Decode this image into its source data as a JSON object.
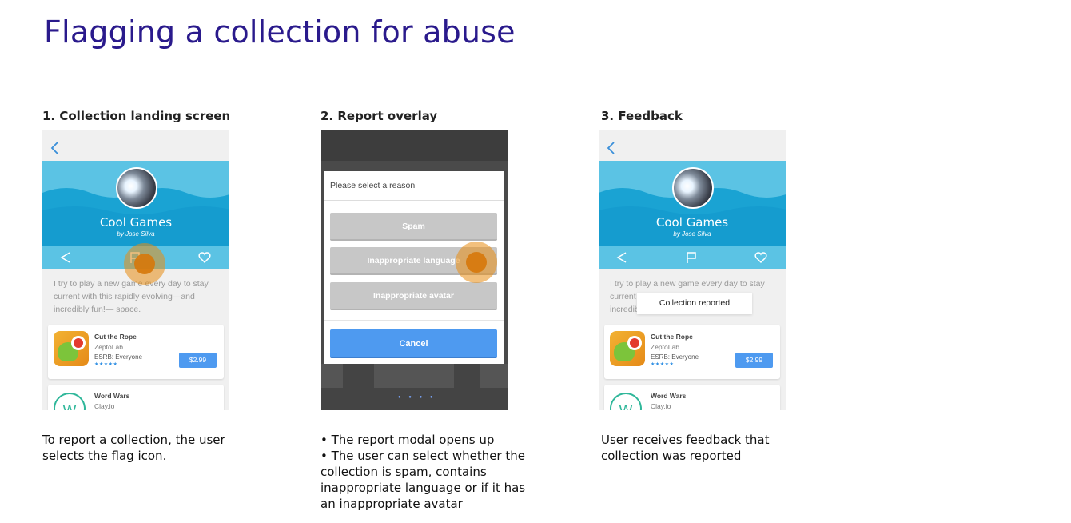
{
  "title": "Flagging a collection for abuse",
  "steps": [
    {
      "heading": "1. Collection landing screen",
      "caption_lines": [
        "To report a collection, the user",
        "selects the flag icon."
      ]
    },
    {
      "heading": "2. Report overlay",
      "caption_lines": [
        "• The report modal opens up",
        "• The user can select whether the",
        "collection is spam, contains",
        "inappropriate language or if it has",
        "an inappropriate avatar"
      ]
    },
    {
      "heading": "3. Feedback",
      "caption_lines": [
        "User receives feedback that",
        "collection was reported"
      ]
    }
  ],
  "collection": {
    "name": "Cool Games",
    "author": "by Jose Silva",
    "description": "I try to play a new game every day to stay current with this rapidly evolving—and incredibly fun!— space."
  },
  "games": [
    {
      "title": "Cut the Rope",
      "developer": "ZeptoLab",
      "esrb": "ESRB: Everyone",
      "stars": "★★★★★",
      "price": "$2.99"
    },
    {
      "title": "Word Wars",
      "developer": "Clay.io",
      "icon_letter": "W"
    }
  ],
  "report_modal": {
    "header": "Please select a reason",
    "options": [
      "Spam",
      "Inappropriate language",
      "Inappropriate avatar"
    ],
    "cancel": "Cancel"
  },
  "feedback": {
    "toast": "Collection reported"
  },
  "colors": {
    "title": "#2a1a8c",
    "hero": "#5bc3e4",
    "button_blue": "#4e9af0",
    "touch": "#e88c12"
  }
}
